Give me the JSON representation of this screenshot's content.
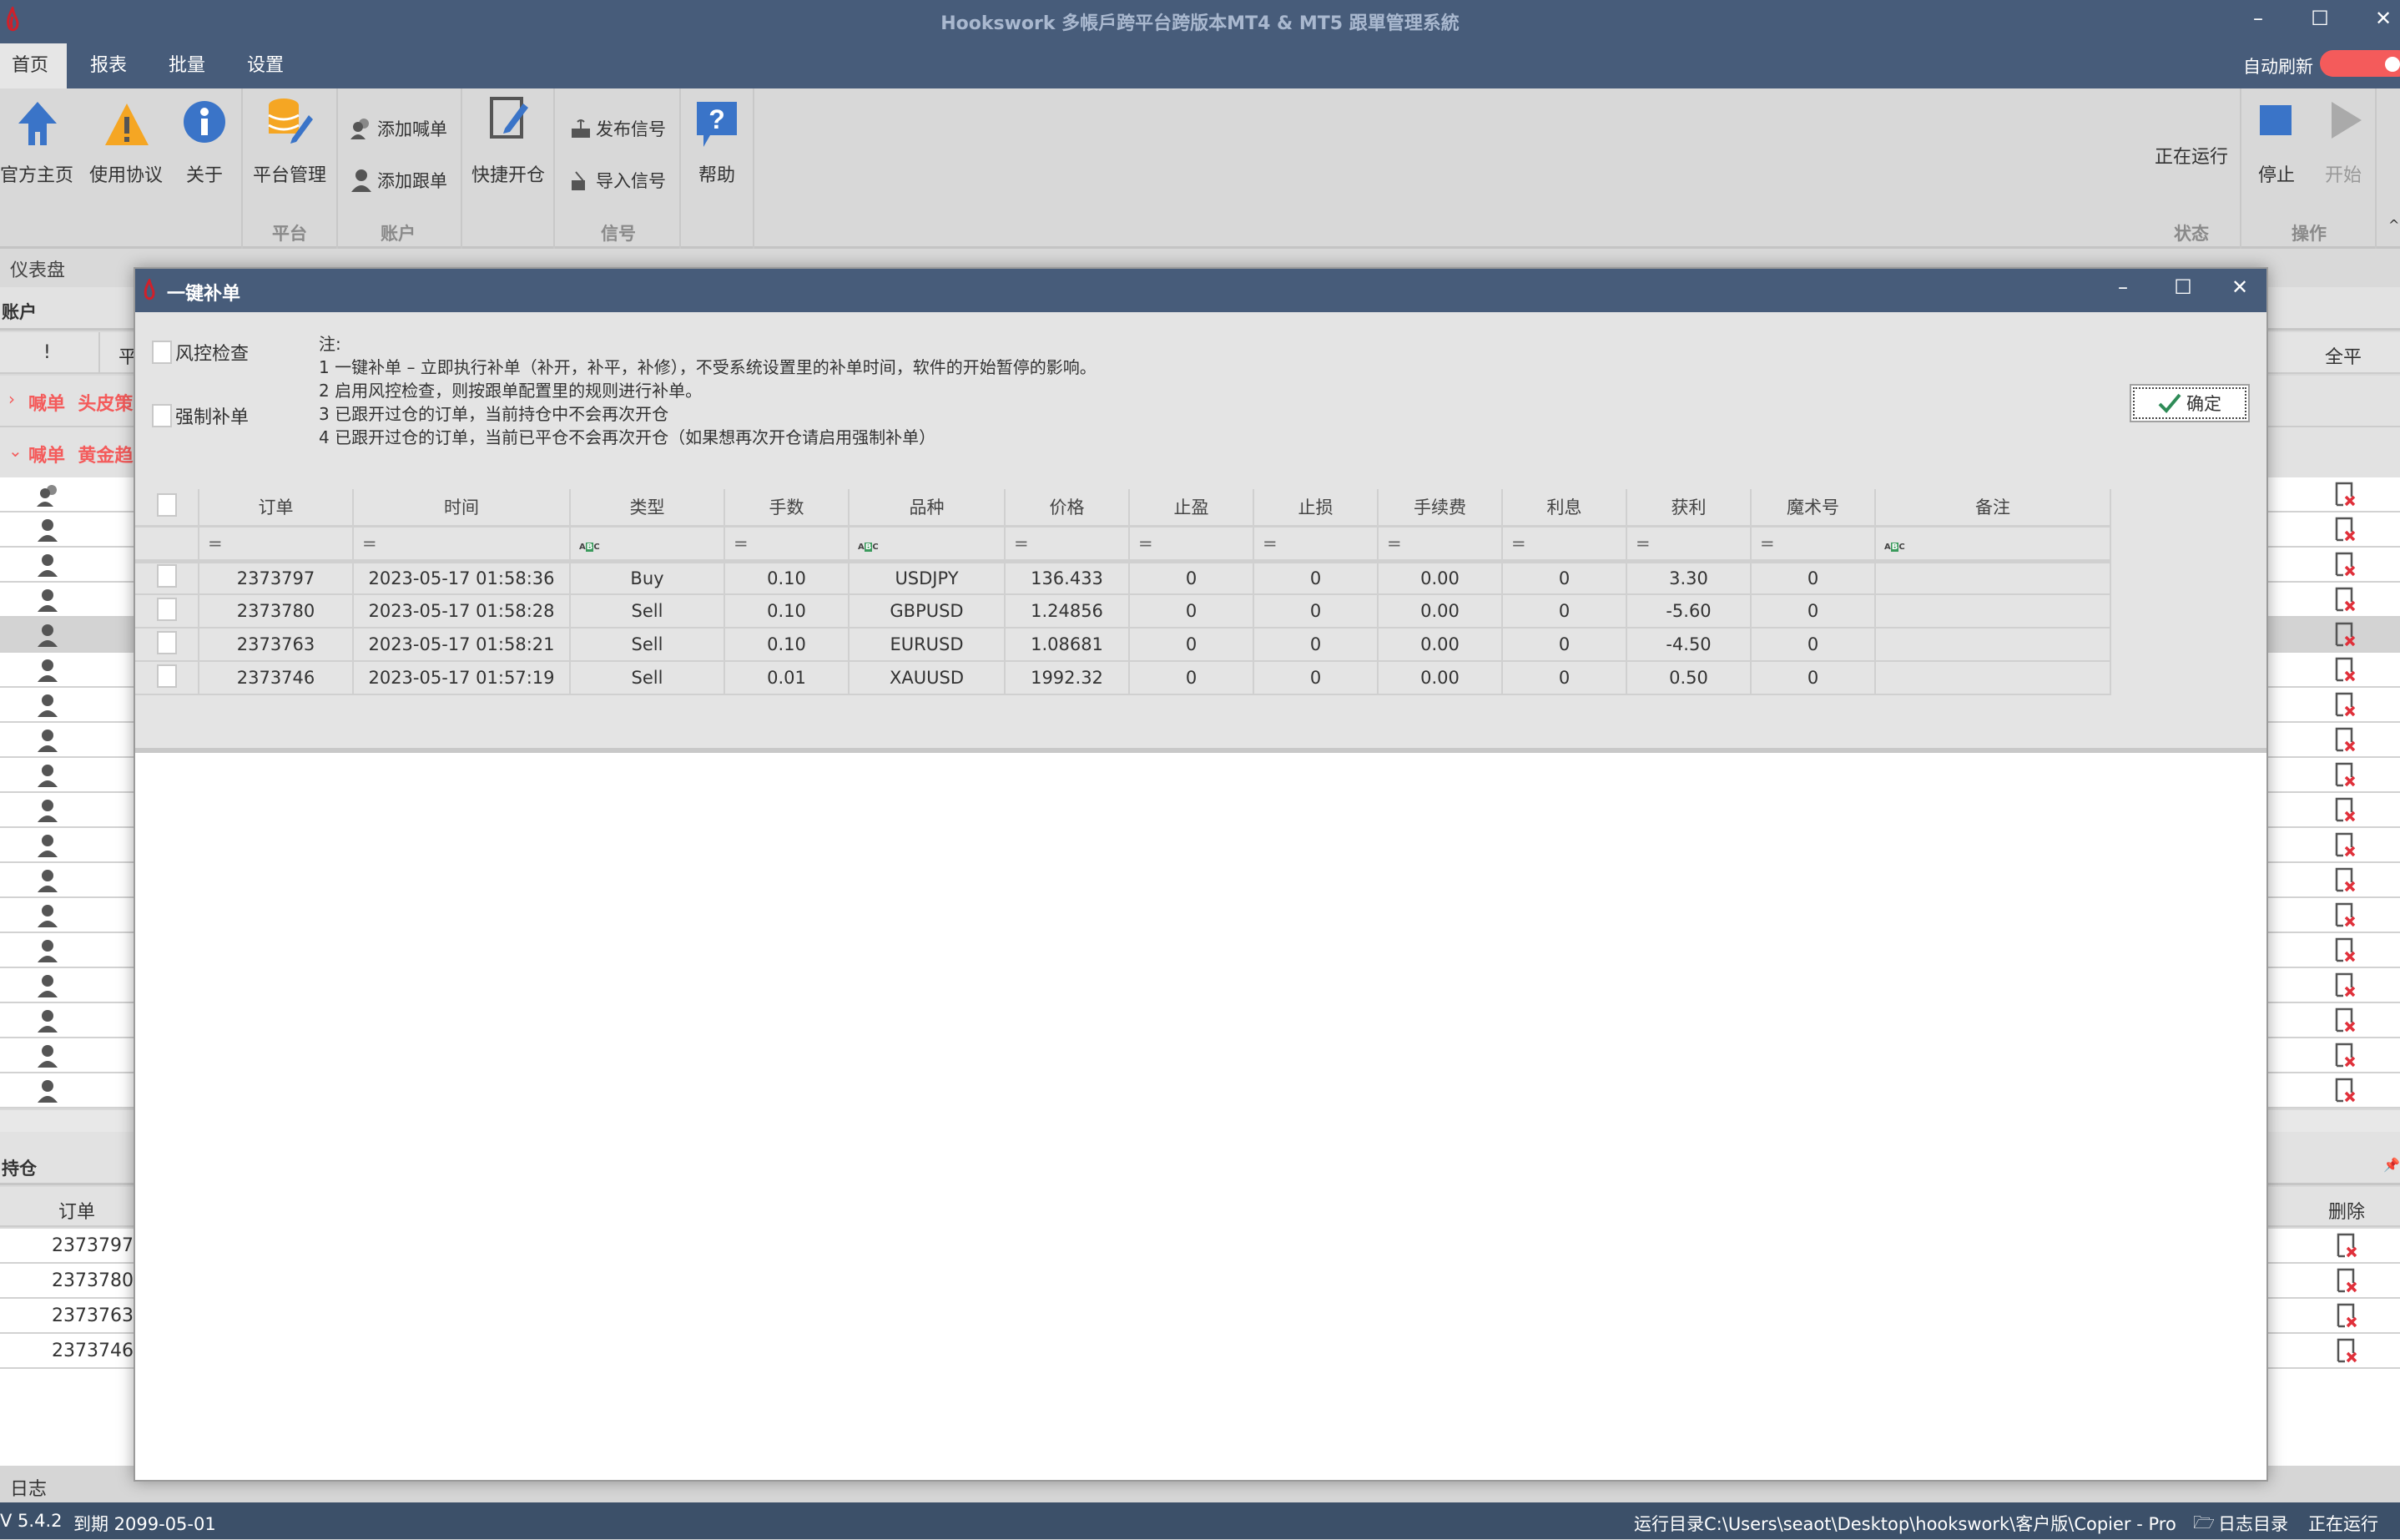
{
  "app": {
    "title": "Hookswork 多帳戶跨平台跨版本MT4 & MT5 跟單管理系統",
    "win_min": "–",
    "win_max": "☐",
    "win_close": "✕"
  },
  "menu": {
    "tabs": [
      {
        "label": "首页",
        "active": true
      },
      {
        "label": "报表"
      },
      {
        "label": "批量"
      },
      {
        "label": "设置"
      }
    ],
    "auto_refresh": "自动刷新",
    "auto_refresh_on": true
  },
  "ribbon": {
    "home": "官方主页",
    "agreement": "使用协议",
    "about": "关于",
    "platform_mgmt": "平台管理",
    "add_signal": "添加喊单",
    "add_follow": "添加跟单",
    "quick_open": "快捷开仓",
    "publish_signal": "发布信号",
    "import_signal": "导入信号",
    "help": "帮助",
    "groups": {
      "platform": "平台",
      "account": "账户",
      "signal": "信号",
      "status": "状态",
      "operation": "操作"
    },
    "status_text": "正在运行",
    "stop": "停止",
    "start": "开始"
  },
  "dashboard": {
    "tab": "仪表盘",
    "account_header": "账户",
    "col_alert": "!",
    "col_ping": "平",
    "col_close_all": "全平",
    "groups": [
      {
        "label": "喊单  头皮策略",
        "expanded": false
      },
      {
        "label": "喊单  黄金趋势",
        "expanded": true
      }
    ],
    "account_rows": 18,
    "selected_row": 4
  },
  "positions": {
    "header": "持仓",
    "col_order": "订单",
    "col_delete": "删除",
    "orders": [
      "2373797",
      "2373780",
      "2373763",
      "2373746"
    ]
  },
  "log_tab": "日志",
  "status": {
    "version": "V 5.4.2",
    "expiry": "到期 2099-05-01",
    "run_dir": "运行目录C:\\Users\\seaot\\Desktop\\hookswork\\客户版\\Copier - Pro",
    "log_dir": "日志目录",
    "running": "正在运行"
  },
  "dialog": {
    "title": "一键补单",
    "min": "–",
    "max": "☐",
    "close": "✕",
    "risk_check": "风控检查",
    "force": "强制补单",
    "ok": "确定",
    "notes": [
      "注:",
      "1 一键补单 – 立即执行补单（补开，补平，补修），不受系统设置里的补单时间，软件的开始暂停的影响。",
      "2 启用风控检查，则按跟单配置里的规则进行补单。",
      "3 已跟开过仓的订单，当前持仓中不会再次开仓",
      "4 已跟开过仓的订单，当前已平仓不会再次开仓（如果想再次开仓请启用强制补单）"
    ],
    "columns": [
      "订单",
      "时间",
      "类型",
      "手数",
      "品种",
      "价格",
      "止盈",
      "止损",
      "手续费",
      "利息",
      "获利",
      "魔术号",
      "备注"
    ],
    "filters": [
      "=",
      "=",
      "abc",
      "=",
      "abc",
      "=",
      "=",
      "=",
      "=",
      "=",
      "=",
      "=",
      "abc"
    ],
    "rows": [
      [
        "2373797",
        "2023-05-17 01:58:36",
        "Buy",
        "0.10",
        "USDJPY",
        "136.433",
        "0",
        "0",
        "0.00",
        "0",
        "3.30",
        "0",
        ""
      ],
      [
        "2373780",
        "2023-05-17 01:58:28",
        "Sell",
        "0.10",
        "GBPUSD",
        "1.24856",
        "0",
        "0",
        "0.00",
        "0",
        "-5.60",
        "0",
        ""
      ],
      [
        "2373763",
        "2023-05-17 01:58:21",
        "Sell",
        "0.10",
        "EURUSD",
        "1.08681",
        "0",
        "0",
        "0.00",
        "0",
        "-4.50",
        "0",
        ""
      ],
      [
        "2373746",
        "2023-05-17 01:57:19",
        "Sell",
        "0.01",
        "XAUUSD",
        "1992.32",
        "0",
        "0",
        "0.00",
        "0",
        "0.50",
        "0",
        ""
      ]
    ]
  },
  "colors": {
    "header": "#475c7a",
    "status_bar": "#3c5069",
    "accent_red": "#f45b5b",
    "icon_blue": "#3a74c8",
    "icon_orange": "#f5a623",
    "abc_green": "#3a9a5c"
  }
}
